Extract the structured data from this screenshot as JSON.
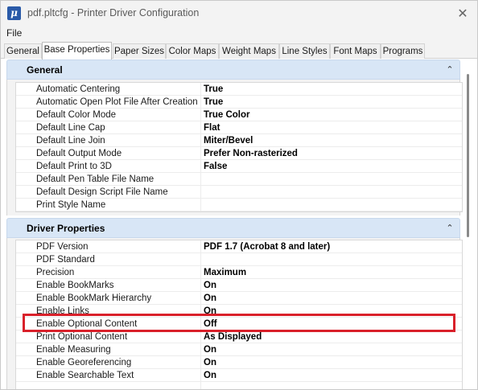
{
  "window": {
    "title": "pdf.pltcfg - Printer Driver Configuration",
    "app_icon_glyph": "μ",
    "close_glyph": "✕"
  },
  "menu": {
    "file": "File"
  },
  "tabs": [
    {
      "label": "General"
    },
    {
      "label": "Base Properties",
      "active": true
    },
    {
      "label": "Paper Sizes"
    },
    {
      "label": "Color Maps"
    },
    {
      "label": "Weight Maps"
    },
    {
      "label": "Line Styles"
    },
    {
      "label": "Font Maps"
    },
    {
      "label": "Programs"
    }
  ],
  "sections": {
    "general": {
      "title": "General",
      "collapse_glyph": "⌃",
      "rows": [
        {
          "name": "Automatic Centering",
          "value": "True"
        },
        {
          "name": "Automatic Open Plot File After Creation",
          "value": "True"
        },
        {
          "name": "Default Color Mode",
          "value": "True Color"
        },
        {
          "name": "Default Line Cap",
          "value": "Flat"
        },
        {
          "name": "Default Line Join",
          "value": "Miter/Bevel"
        },
        {
          "name": "Default Output Mode",
          "value": "Prefer Non-rasterized"
        },
        {
          "name": "Default Print to 3D",
          "value": "False"
        },
        {
          "name": "Default Pen Table File Name",
          "value": ""
        },
        {
          "name": "Default Design Script File Name",
          "value": ""
        },
        {
          "name": "Print Style Name",
          "value": ""
        }
      ]
    },
    "driver": {
      "title": "Driver Properties",
      "collapse_glyph": "⌃",
      "rows": [
        {
          "name": "PDF Version",
          "value": "PDF 1.7 (Acrobat 8 and later)"
        },
        {
          "name": "PDF Standard",
          "value": ""
        },
        {
          "name": "Precision",
          "value": "Maximum"
        },
        {
          "name": "Enable BookMarks",
          "value": "On"
        },
        {
          "name": "Enable BookMark Hierarchy",
          "value": "On"
        },
        {
          "name": "Enable Links",
          "value": "On"
        },
        {
          "name": "Enable Optional Content",
          "value": "Off"
        },
        {
          "name": "Print Optional Content",
          "value": "As Displayed"
        },
        {
          "name": "Enable Measuring",
          "value": "On"
        },
        {
          "name": "Enable Georeferencing",
          "value": "On"
        },
        {
          "name": "Enable Searchable Text",
          "value": "On"
        }
      ]
    }
  },
  "highlight_color": "#d9202a"
}
